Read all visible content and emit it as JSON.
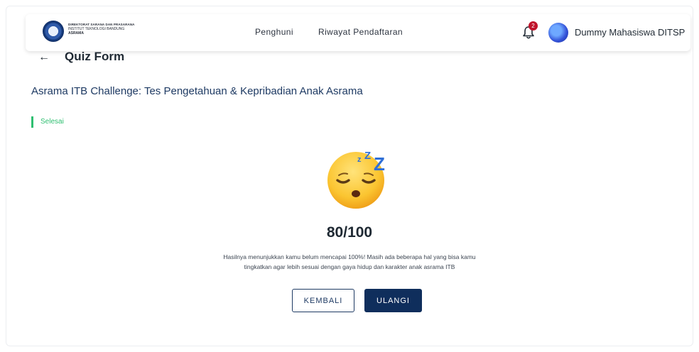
{
  "header": {
    "logo_lines": [
      "DIREKTORAT SARANA DAN PRASARANA",
      "INSTITUT TEKNOLOGI BANDUNG",
      "ASRAMA"
    ],
    "nav": [
      "Penghuni",
      "Riwayat Pendaftaran"
    ],
    "notification_count": "2",
    "user_name": "Dummy Mahasiswa DITSP"
  },
  "page": {
    "back_icon": "←",
    "title": "Quiz Form",
    "quiz_title": "Asrama ITB Challenge: Tes Pengetahuan & Kepribadian Anak Asrama",
    "status": "Selesai"
  },
  "result": {
    "emoji_icon": "sleeping-face-icon",
    "score": "80/100",
    "description_line1": "Hasilnya menunjukkan kamu belum mencapai 100%! Masih ada beberapa hal yang bisa kamu",
    "description_line2": "tingkatkan agar lebih sesuai dengan gaya hidup dan karakter anak asrama ITB"
  },
  "actions": {
    "back_label": "KEMBALI",
    "retry_label": "ULANGI"
  },
  "colors": {
    "primary": "#0f2e5c",
    "success": "#2fbf71",
    "badge": "#c0132b"
  }
}
